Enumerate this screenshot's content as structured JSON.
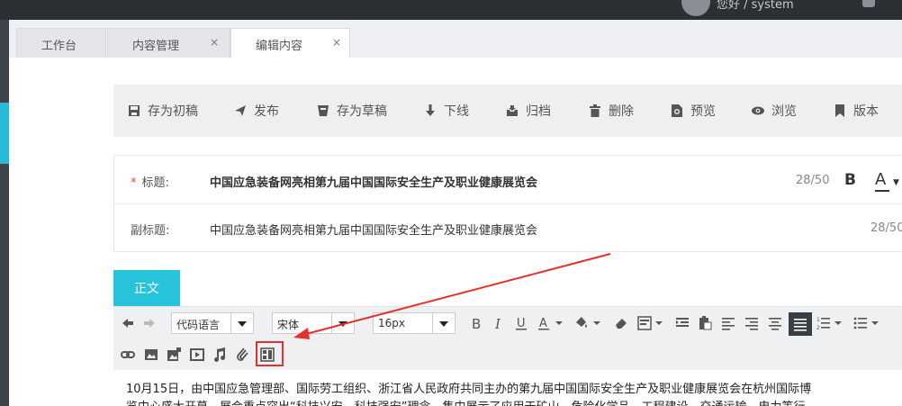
{
  "topbar": {
    "user_text": "您好 / system"
  },
  "tabs": [
    {
      "label": "工作台",
      "closable": false
    },
    {
      "label": "内容管理",
      "closable": true,
      "close": "×"
    },
    {
      "label": "编辑内容",
      "closable": true,
      "close": "×",
      "active": true
    }
  ],
  "actions": {
    "save_initial": "存为初稿",
    "publish": "发布",
    "save_draft": "存为草稿",
    "offline": "下线",
    "archive": "归档",
    "delete": "删除",
    "preview": "预览",
    "browse": "浏览",
    "version": "版本"
  },
  "title_form": {
    "required_mark": "*",
    "title_label": "标题:",
    "title_value": "中国应急装备网亮相第九届中国国际安全生产及职业健康展览会",
    "title_count": "28/50",
    "bold_label": "B",
    "font_color_label": "A",
    "subtitle_label": "副标题:",
    "subtitle_value": "中国应急装备网亮相第九届中国国际安全生产及职业健康展览会",
    "subtitle_count": "28/50"
  },
  "editor": {
    "tab_label": "正文",
    "format_select": "代码语言",
    "font_select": "宋体",
    "size_select": "16px",
    "body_line1": "10月15日，由中国应急管理部、国际劳工组织、浙江省人民政府共同主办的第九届中国国际安全生产及职业健康展览会在杭州国际博",
    "body_line2": "览中心盛大开幕。展会重点突出“科技兴安、科技强安”理念，集中展示了应用于矿山、危险化学品、工程建设、交通运输、电力等行"
  },
  "colors": {
    "accent": "#27c3dd",
    "highlight": "#e53030",
    "topbar": "#2b3035",
    "sidebar": "#3d434a"
  }
}
